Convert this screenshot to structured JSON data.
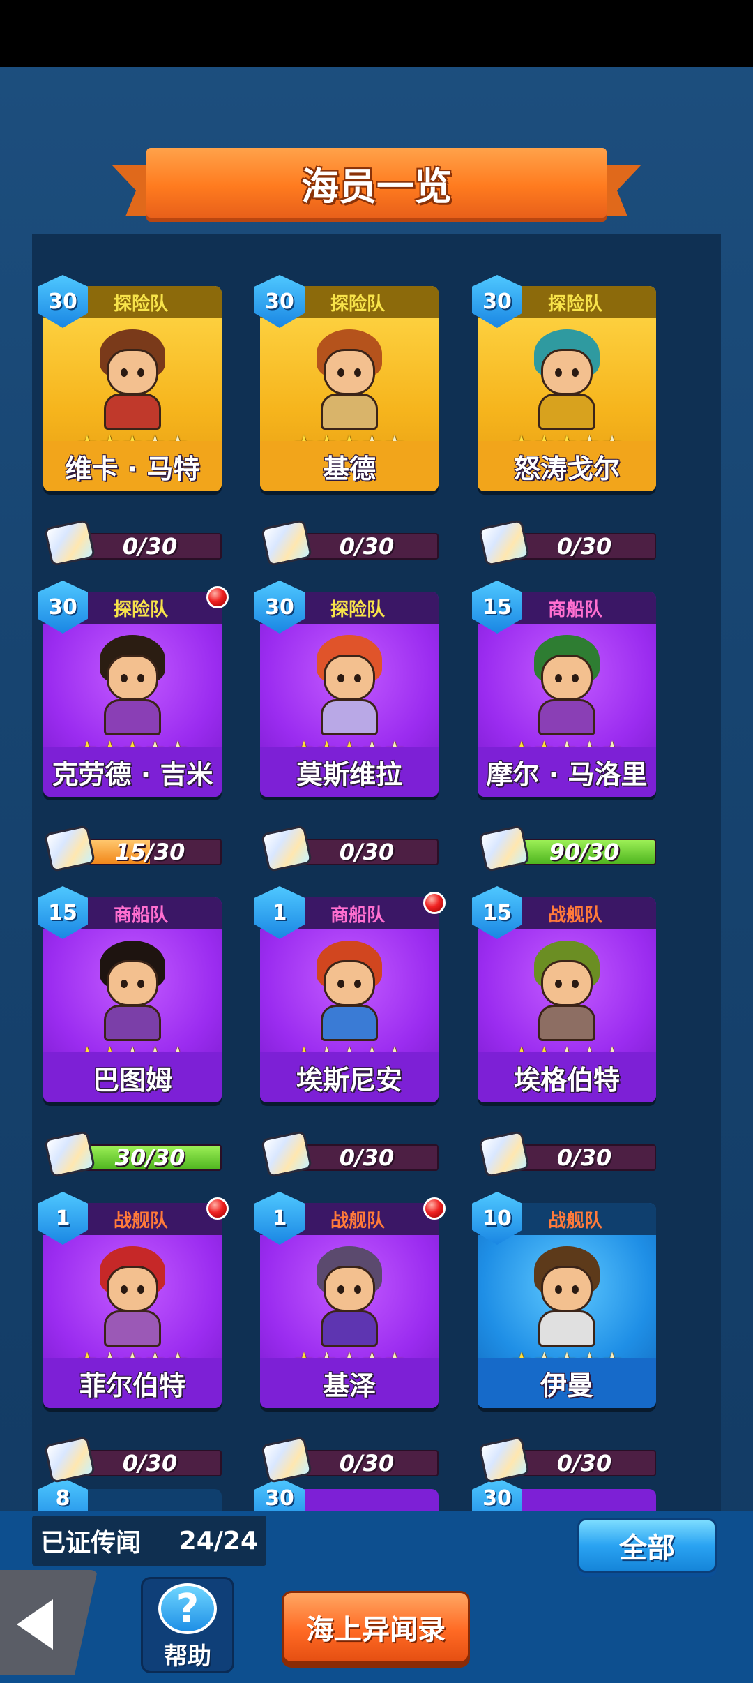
{
  "title": "海员一览",
  "crew": [
    {
      "level": "30",
      "team": "探险队",
      "team_type": "explore",
      "name": "维卡 · 马特",
      "stars": 3,
      "progress_text": "0/30",
      "progress": 0,
      "rarity": "gold",
      "alert": false,
      "hair": "#7a3a1a",
      "outfit": "#c0392b"
    },
    {
      "level": "30",
      "team": "探险队",
      "team_type": "explore",
      "name": "基德",
      "stars": 3,
      "progress_text": "0/30",
      "progress": 0,
      "rarity": "gold",
      "alert": false,
      "hair": "#b5531c",
      "outfit": "#d9b46a"
    },
    {
      "level": "30",
      "team": "探险队",
      "team_type": "explore",
      "name": "怒涛戈尔",
      "stars": 3,
      "progress_text": "0/30",
      "progress": 0,
      "rarity": "gold",
      "alert": false,
      "hair": "#2f9aa0",
      "outfit": "#d8a21e"
    },
    {
      "level": "30",
      "team": "探险队",
      "team_type": "explore",
      "name": "克劳德 · 吉米",
      "stars": 3,
      "progress_text": "15/30",
      "progress": 0.5,
      "rarity": "purple",
      "alert": true,
      "hair": "#2b1d12",
      "outfit": "#8a3fb5"
    },
    {
      "level": "30",
      "team": "探险队",
      "team_type": "explore",
      "name": "莫斯维拉",
      "stars": 3,
      "progress_text": "0/30",
      "progress": 0,
      "rarity": "purple",
      "alert": false,
      "hair": "#e0542a",
      "outfit": "#b9a8e6"
    },
    {
      "level": "15",
      "team": "商船队",
      "team_type": "merchant",
      "name": "摩尔 · 马洛里",
      "stars": 2,
      "progress_text": "90/30",
      "progress": 1,
      "rarity": "purple",
      "alert": false,
      "hair": "#2e7d32",
      "outfit": "#8a3fb5"
    },
    {
      "level": "15",
      "team": "商船队",
      "team_type": "merchant",
      "name": "巴图姆",
      "stars": 2,
      "progress_text": "30/30",
      "progress": 1,
      "rarity": "purple",
      "alert": false,
      "hair": "#1e1410",
      "outfit": "#7b3fa8"
    },
    {
      "level": "1",
      "team": "商船队",
      "team_type": "merchant",
      "name": "埃斯尼安",
      "stars": 1,
      "progress_text": "0/30",
      "progress": 0,
      "rarity": "purple",
      "alert": true,
      "hair": "#d1461f",
      "outfit": "#3a7bd5"
    },
    {
      "level": "15",
      "team": "战舰队",
      "team_type": "warship",
      "name": "埃格伯特",
      "stars": 2,
      "progress_text": "0/30",
      "progress": 0,
      "rarity": "purple",
      "alert": false,
      "hair": "#6b8e23",
      "outfit": "#8d6e63"
    },
    {
      "level": "1",
      "team": "战舰队",
      "team_type": "warship",
      "name": "菲尔伯特",
      "stars": 1,
      "progress_text": "0/30",
      "progress": 0,
      "rarity": "purple",
      "alert": true,
      "hair": "#c62828",
      "outfit": "#9b59b6"
    },
    {
      "level": "1",
      "team": "战舰队",
      "team_type": "warship",
      "name": "基泽",
      "stars": 1,
      "progress_text": "0/30",
      "progress": 0,
      "rarity": "purple",
      "alert": true,
      "hair": "#5b4a6e",
      "outfit": "#5e35b1"
    },
    {
      "level": "10",
      "team": "战舰队",
      "team_type": "warship",
      "name": "伊曼",
      "stars": 1,
      "progress_text": "0/30",
      "progress": 0,
      "rarity": "blue",
      "alert": false,
      "hair": "#5d3a1a",
      "outfit": "#e0e0e0"
    }
  ],
  "partial_row": [
    {
      "level": "8",
      "rarity": "blue"
    },
    {
      "level": "30",
      "rarity": "purple"
    },
    {
      "level": "30",
      "rarity": "purple"
    }
  ],
  "footer": {
    "verified_label": "已证传闻",
    "verified_count": "24/24",
    "filter_label": "全部",
    "help_label": "帮助",
    "help_glyph": "?",
    "log_label": "海上异闻录"
  },
  "colors": {
    "accent_orange": "#ff7b1f",
    "accent_blue": "#2aa3f2",
    "progress_full": "#4fb520",
    "progress_partial": "#f1871a"
  }
}
